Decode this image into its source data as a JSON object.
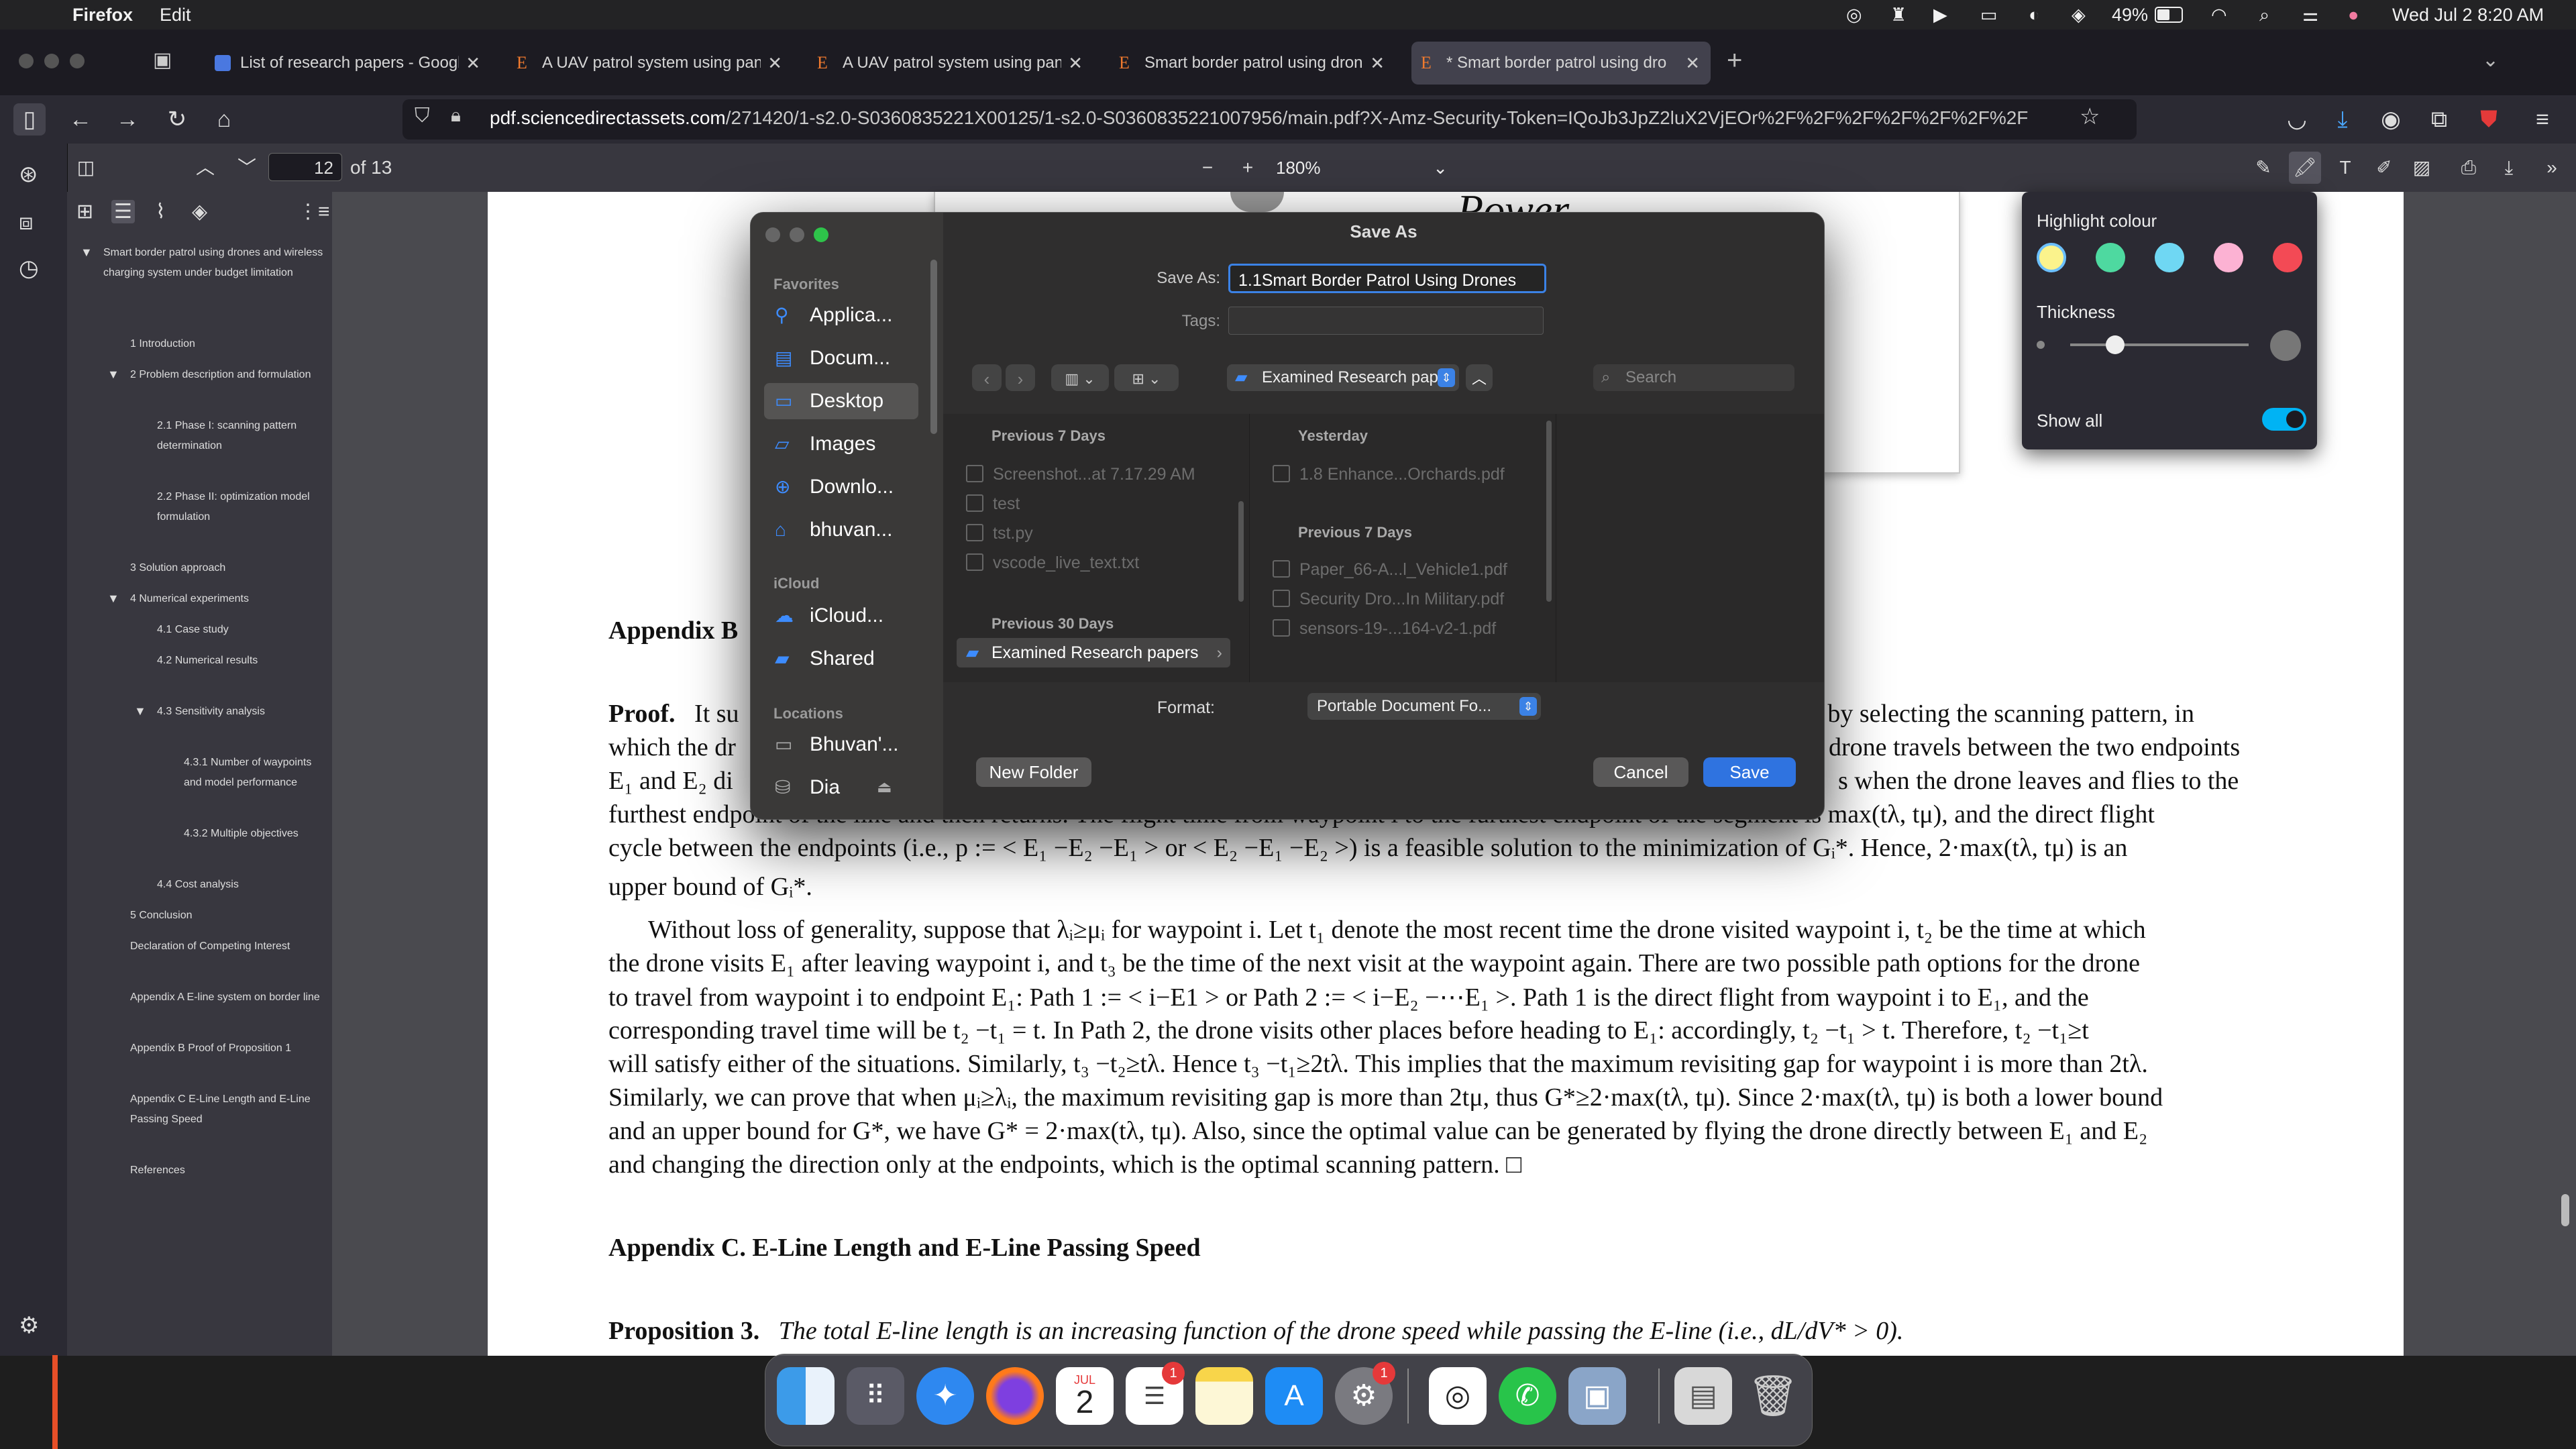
{
  "menubar": {
    "app": "Firefox",
    "edit": "Edit",
    "battery": "49%",
    "datetime": "Wed Jul 2  8:20 AM"
  },
  "tabs": [
    {
      "label": "List of research papers - Google",
      "active": false
    },
    {
      "label": "A UAV patrol system using panc",
      "active": false
    },
    {
      "label": "A UAV patrol system using panc",
      "active": false
    },
    {
      "label": "Smart border patrol using drone",
      "active": false
    },
    {
      "label": "* Smart border patrol using dro",
      "active": true
    }
  ],
  "url": {
    "host": "pdf.sciencedirectassets.com",
    "path": "/271420/1-s2.0-S0360835221X00125/1-s2.0-S0360835221007956/main.pdf?X-Amz-Security-Token=IQoJb3JpZ2luX2VjEOr%2F%2F%2F%2F%2F%2F%2F"
  },
  "pdf_toolbar": {
    "page": "12",
    "of_pages": "of 13",
    "zoom": "180%"
  },
  "outline": [
    {
      "text": "Smart border patrol using drones and wireless charging system under budget limitation",
      "level": 0,
      "tri": true
    },
    {
      "text": "1 Introduction",
      "level": 1
    },
    {
      "text": "2 Problem description and formulation",
      "level": 1,
      "tri": true
    },
    {
      "text": "2.1 Phase I: scanning pattern determination",
      "level": 2
    },
    {
      "text": "2.2 Phase II: optimization model formulation",
      "level": 2
    },
    {
      "text": "3 Solution approach",
      "level": 1
    },
    {
      "text": "4 Numerical experiments",
      "level": 1,
      "tri": true
    },
    {
      "text": "4.1 Case study",
      "level": 2
    },
    {
      "text": "4.2 Numerical results",
      "level": 2
    },
    {
      "text": "4.3 Sensitivity analysis",
      "level": 2,
      "tri": true
    },
    {
      "text": "4.3.1 Number of waypoints and model performance",
      "level": 3
    },
    {
      "text": "4.3.2 Multiple objectives",
      "level": 3
    },
    {
      "text": "4.4 Cost analysis",
      "level": 2
    },
    {
      "text": "5 Conclusion",
      "level": 1
    },
    {
      "text": "Declaration of Competing Interest",
      "level": 1
    },
    {
      "text": "Appendix A E-line system on border line",
      "level": 1
    },
    {
      "text": "Appendix B Proof of Proposition 1",
      "level": 1
    },
    {
      "text": "Appendix C E-Line Length and E-Line Passing Speed",
      "level": 1
    },
    {
      "text": "References",
      "level": 1
    }
  ],
  "dialog": {
    "title": "Save As",
    "save_as_label": "Save As:",
    "save_as_value": "1.1Smart Border Patrol Using Drones",
    "tags_label": "Tags:",
    "location": "Examined Research pap...",
    "search_placeholder": "Search",
    "favorites_header": "Favorites",
    "favorites": [
      {
        "label": "Applica...",
        "icon": "applications-icon"
      },
      {
        "label": "Docum...",
        "icon": "documents-icon"
      },
      {
        "label": "Desktop",
        "icon": "desktop-icon"
      },
      {
        "label": "Images",
        "icon": "folder-icon"
      },
      {
        "label": "Downlo...",
        "icon": "downloads-icon"
      },
      {
        "label": "bhuvan...",
        "icon": "home-icon"
      }
    ],
    "icloud_header": "iCloud",
    "icloud": [
      {
        "label": "iCloud...",
        "icon": "cloud-icon"
      },
      {
        "label": "Shared",
        "icon": "shared-folder-icon"
      }
    ],
    "locations_header": "Locations",
    "locations": [
      {
        "label": "Bhuvan'...",
        "icon": "laptop-icon"
      },
      {
        "label": "Dia",
        "icon": "drive-icon"
      }
    ],
    "col1_header1": "Previous 7 Days",
    "col1_files": [
      "Screenshot...at 7.17.29 AM",
      "test",
      "tst.py",
      "vscode_live_text.txt"
    ],
    "col1_header2": "Previous 30 Days",
    "col1_folder": "Examined Research papers",
    "col2_header1": "Yesterday",
    "col2_files1": [
      "1.8 Enhance...Orchards.pdf"
    ],
    "col2_header2": "Previous 7 Days",
    "col2_files2": [
      "Paper_66-A...l_Vehicle1.pdf",
      "Security Dro...In Military.pdf",
      "sensors-19-...164-v2-1.pdf"
    ],
    "format_label": "Format:",
    "format_value": "Portable Document Fo...",
    "new_folder": "New Folder",
    "cancel": "Cancel",
    "save": "Save"
  },
  "highlight_popup": {
    "title": "Highlight colour",
    "colors": [
      "#fbf38c",
      "#4ed9a0",
      "#6fd7f3",
      "#fcb2d3",
      "#f34a55"
    ],
    "thickness_label": "Thickness",
    "thickness_value": 0.25,
    "show_all_label": "Show all",
    "show_all_on": true
  },
  "pdf_content": {
    "figure_text": "Power",
    "appendix_b_partial": "Appendix B",
    "proof_lines": [
      [
        "Proof.",
        "It su",
        "ved by selecting the scanning pattern, in"
      ],
      [
        "which the dr",
        "drone travels between the two endpoints"
      ],
      [
        "E₁ and E₂ di",
        "s when the drone leaves and flies to the"
      ],
      [
        "furthest endpoint of the line and then returns. The flight time from waypoint i to the furthest endpoint of the segment is max(tλ, tμ), and the direct flight"
      ]
    ],
    "body_lines": [
      "cycle between the endpoints (i.e., p := < E₁ −E₂ −E₁ > or < E₂ −E₁ −E₂ >) is a feasible solution to the minimization of Gᵢ*. Hence, 2·max(tλ, tμ) is an",
      "upper bound of Gᵢ*.",
      "Without loss of generality, suppose that λᵢ≥μᵢ for waypoint i. Let t₁ denote the most recent time the drone visited waypoint i, t₂ be the time at which",
      "the drone visits E₁ after leaving waypoint i, and t₃ be the time of the next visit at the waypoint again. There are two possible path options for the drone",
      "to travel from waypoint i to endpoint E₁: Path 1 := < i−E1 > or Path 2 := < i−E₂ −⋯E₁ >. Path 1 is the direct flight from waypoint i to E₁, and the",
      "corresponding travel time will be t₂ −t₁ = t. In Path 2, the drone visits other places before heading to E₁: accordingly, t₂ −t₁ > t. Therefore, t₂ −t₁≥t",
      "will satisfy either of the situations. Similarly, t₃ −t₂≥tλ. Hence t₃ −t₁≥2tλ. This implies that the maximum revisiting gap for waypoint i is more than 2tλ.",
      "Similarly, we can prove that when μᵢ≥λᵢ, the maximum revisiting gap is more than 2tμ, thus G*≥2·max(tλ, tμ). Since 2·max(tλ, tμ) is both a lower bound",
      "and an upper bound for G*, we have G* = 2·max(tλ, tμ). Also, since the optimal value can be generated by flying the drone directly between E₁ and E₂",
      "and changing the direction only at the endpoints, which is the optimal scanning pattern. □"
    ],
    "appendix_c": "Appendix C.  E-Line Length and E-Line Passing Speed",
    "prop3_label": "Proposition 3.",
    "prop3_text": "The total E-line length is an increasing function of the drone speed while passing the E-line (i.e., dL/dV* > 0)."
  },
  "dock": {
    "items": [
      "finder-icon",
      "launchpad-icon",
      "safari-icon",
      "firefox-icon",
      "calendar-icon",
      "reminders-icon",
      "notes-icon",
      "app-store-icon",
      "system-settings-icon",
      "chatgpt-icon",
      "whatsapp-icon",
      "preview-icon",
      "documents-stack-icon",
      "trash-icon"
    ],
    "calendar_month": "JUL",
    "calendar_day": "2",
    "reminders_badge": "1",
    "settings_badge": "1"
  }
}
